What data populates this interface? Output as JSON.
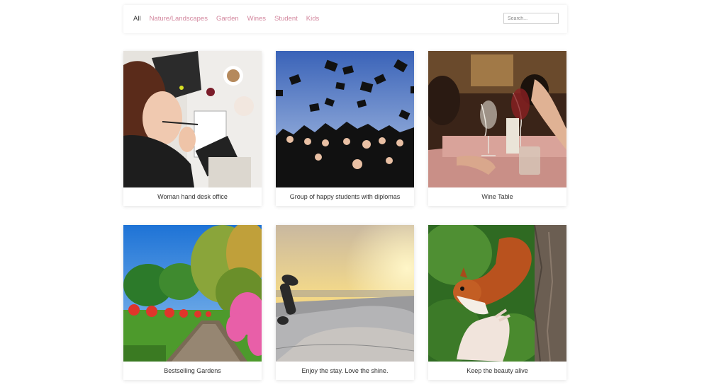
{
  "filters": {
    "items": [
      {
        "label": "All",
        "active": true
      },
      {
        "label": "Nature/Landscapes",
        "active": false
      },
      {
        "label": "Garden",
        "active": false
      },
      {
        "label": "Wines",
        "active": false
      },
      {
        "label": "Student",
        "active": false
      },
      {
        "label": "Kids",
        "active": false
      }
    ],
    "accent_color": "#d3879e"
  },
  "search": {
    "placeholder": "Search..."
  },
  "gallery": {
    "items": [
      {
        "caption": "Woman hand desk office"
      },
      {
        "caption": "Group of happy students with diplomas"
      },
      {
        "caption": "Wine Table"
      },
      {
        "caption": "Bestselling Gardens"
      },
      {
        "caption": "Enjoy the stay. Love the shine."
      },
      {
        "caption": "Keep the beauty alive"
      }
    ]
  }
}
